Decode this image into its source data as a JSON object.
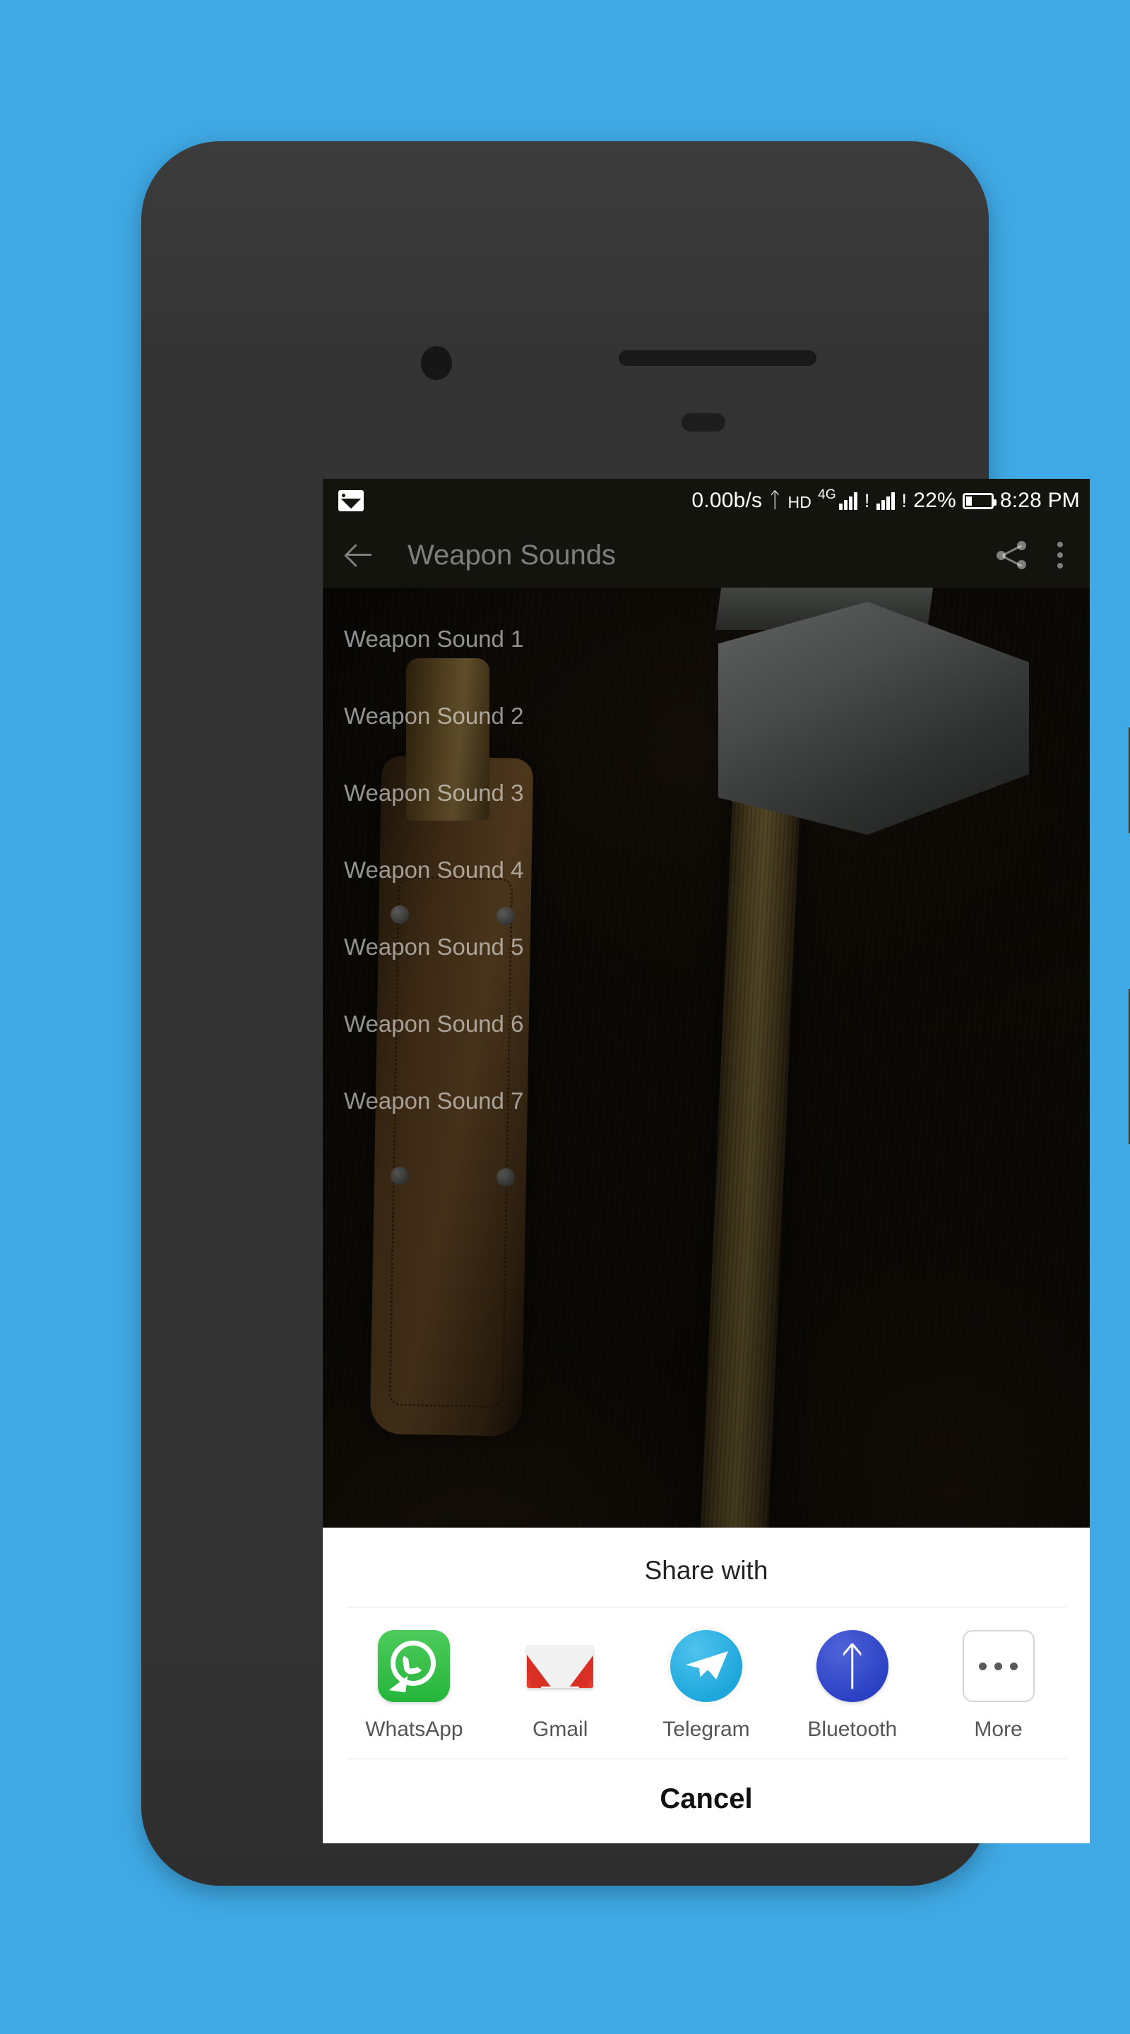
{
  "background": {
    "color": "#3fa9e5"
  },
  "device": {
    "body_color": "#333333",
    "camera": "front-camera",
    "speaker": "earpiece-speaker",
    "buttons": [
      "volume",
      "power"
    ]
  },
  "status_bar": {
    "left_icon": "image-icon",
    "network_speed": "0.00b/s",
    "bluetooth_icon": "bluetooth-icon",
    "volte_label": "HD",
    "network_type": "4G",
    "sim1_alert": "!",
    "sim2_alert": "!",
    "battery_percent": "22%",
    "battery_icon": "battery-icon",
    "time": "8:28 PM"
  },
  "app_bar": {
    "back_icon": "back-arrow-icon",
    "title": "Weapon Sounds",
    "share_icon": "share-icon",
    "overflow_icon": "overflow-menu-icon"
  },
  "sound_list": {
    "items": [
      {
        "label": "Weapon Sound 1"
      },
      {
        "label": "Weapon Sound 2"
      },
      {
        "label": "Weapon Sound 3"
      },
      {
        "label": "Weapon Sound 4"
      },
      {
        "label": "Weapon Sound 5"
      },
      {
        "label": "Weapon Sound 6"
      },
      {
        "label": "Weapon Sound 7"
      }
    ]
  },
  "share_sheet": {
    "title": "Share with",
    "apps": [
      {
        "label": "WhatsApp",
        "icon": "whatsapp-icon",
        "color": "#25b53a"
      },
      {
        "label": "Gmail",
        "icon": "gmail-icon",
        "color": "#d93025"
      },
      {
        "label": "Telegram",
        "icon": "telegram-icon",
        "color": "#1fa7dc"
      },
      {
        "label": "Bluetooth",
        "icon": "bluetooth-icon",
        "color": "#2b41c4"
      },
      {
        "label": "More",
        "icon": "more-dots-icon",
        "color": "#5a5a5a"
      }
    ],
    "cancel_label": "Cancel"
  }
}
